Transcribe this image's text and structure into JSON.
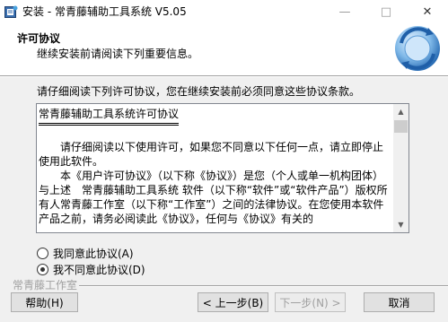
{
  "window": {
    "title": "安装 - 常青藤辅助工具系统 V5.05",
    "minimize": "—",
    "maximize": "□",
    "close": "✕"
  },
  "header": {
    "title": "许可协议",
    "subtitle": "继续安装前请阅读下列重要信息。"
  },
  "prompt": "请仔细阅读下列许可协议，您在继续安装前必须同意这些协议条款。",
  "license": {
    "heading": "常青藤辅助工具系统许可协议",
    "paragraphs": [
      "　　请仔细阅读以下使用许可，如果您不同意以下任何一点，请立即停止使用此软件。",
      "　　本《用户许可协议》（以下称《协议》）是您（个人或单一机构团体）与上述　常青藤辅助工具系统 软件（以下称“软件”或“软件产品”）版权所有人常青藤工作室（以下称“工作室”）之间的法律协议。在您使用本软件产品之前，请务必阅读此《协议》，任何与《协议》有关的"
    ]
  },
  "options": {
    "accept": "我同意此协议(A)",
    "decline": "我不同意此协议(D)",
    "selected": "decline"
  },
  "brand": "常青藤工作室",
  "buttons": {
    "help": "帮助(H)",
    "back": "< 上一步(B)",
    "next": "下一步(N) >",
    "cancel": "取消"
  }
}
